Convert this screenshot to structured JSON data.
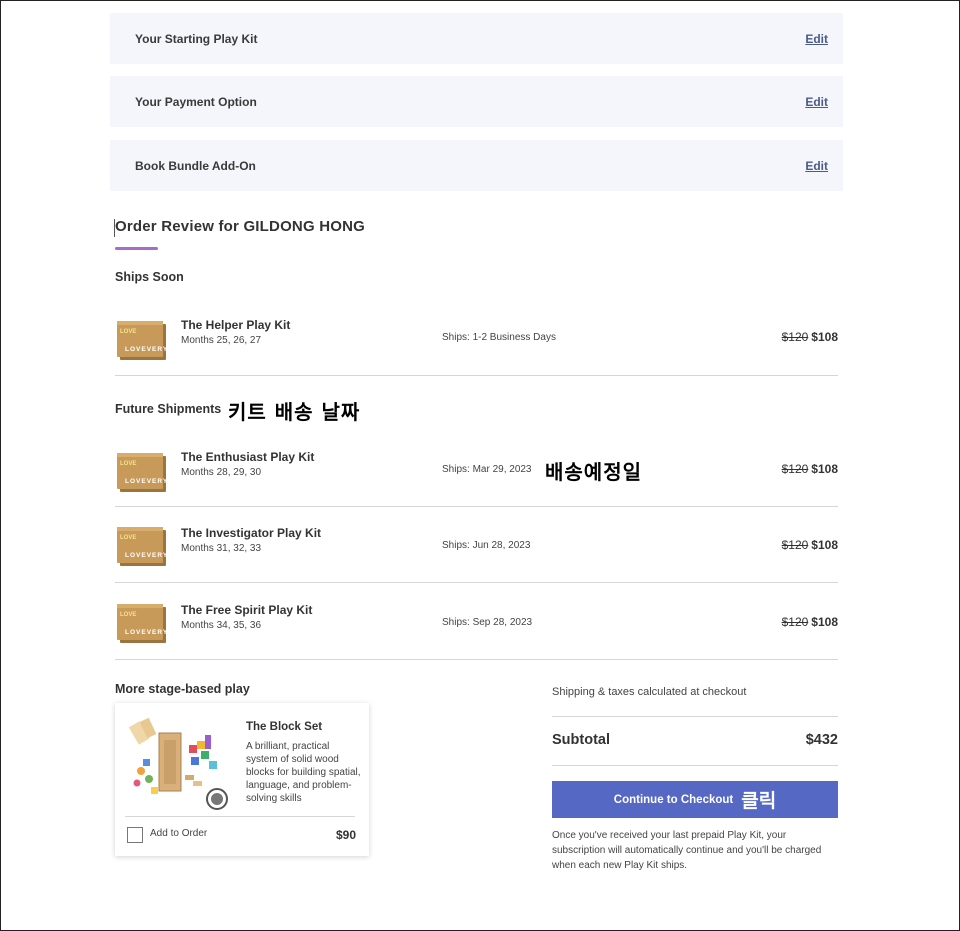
{
  "steps": [
    {
      "title": "Your Starting Play Kit",
      "action": "Edit"
    },
    {
      "title": "Your Payment Option",
      "action": "Edit"
    },
    {
      "title": "Book Bundle Add-On",
      "action": "Edit"
    }
  ],
  "order": {
    "title": "Order Review for GILDONG HONG",
    "ships_soon_heading": "Ships Soon",
    "future_heading": "Future Shipments",
    "future_annotation": "키트 배송 날짜",
    "ship_date_annotation": "배송예정일",
    "kits": [
      {
        "name": "The Helper Play Kit",
        "months": "Months 25, 26, 27",
        "ships": "Ships: 1-2 Business Days",
        "old_price": "$120",
        "price": "$108",
        "box_color": "#c99b5c"
      },
      {
        "name": "The Enthusiast Play Kit",
        "months": "Months 28, 29, 30",
        "ships": "Ships: Mar 29, 2023",
        "old_price": "$120",
        "price": "$108",
        "box_color": "#c99b5c"
      },
      {
        "name": "The Investigator Play Kit",
        "months": "Months 31, 32, 33",
        "ships": "Ships: Jun 28, 2023",
        "old_price": "$120",
        "price": "$108",
        "box_color": "#c99b5c"
      },
      {
        "name": "The Free Spirit Play Kit",
        "months": "Months 34, 35, 36",
        "ships": "Ships: Sep 28, 2023",
        "old_price": "$120",
        "price": "$108",
        "box_color": "#c99b5c"
      }
    ]
  },
  "upsell": {
    "heading": "More stage-based play",
    "product_name": "The Block Set",
    "product_desc": "A brilliant, practical system of solid wood blocks for building spatial, language, and problem-solving skills",
    "add_label": "Add to Order",
    "price": "$90"
  },
  "summary": {
    "shipping_note": "Shipping & taxes calculated at checkout",
    "subtotal_label": "Subtotal",
    "subtotal_value": "$432",
    "checkout_label": "Continue to Checkout",
    "checkout_annotation": "클릭",
    "fine_print": "Once you've received your last prepaid Play Kit, your subscription will automatically continue and you'll be charged when each new Play Kit ships."
  },
  "colors": {
    "accent": "#a66cc8",
    "button": "#5468c4",
    "step_bg": "#f5f6fb",
    "link": "#4a5b8a"
  },
  "box_logo": "LOVEVERY"
}
